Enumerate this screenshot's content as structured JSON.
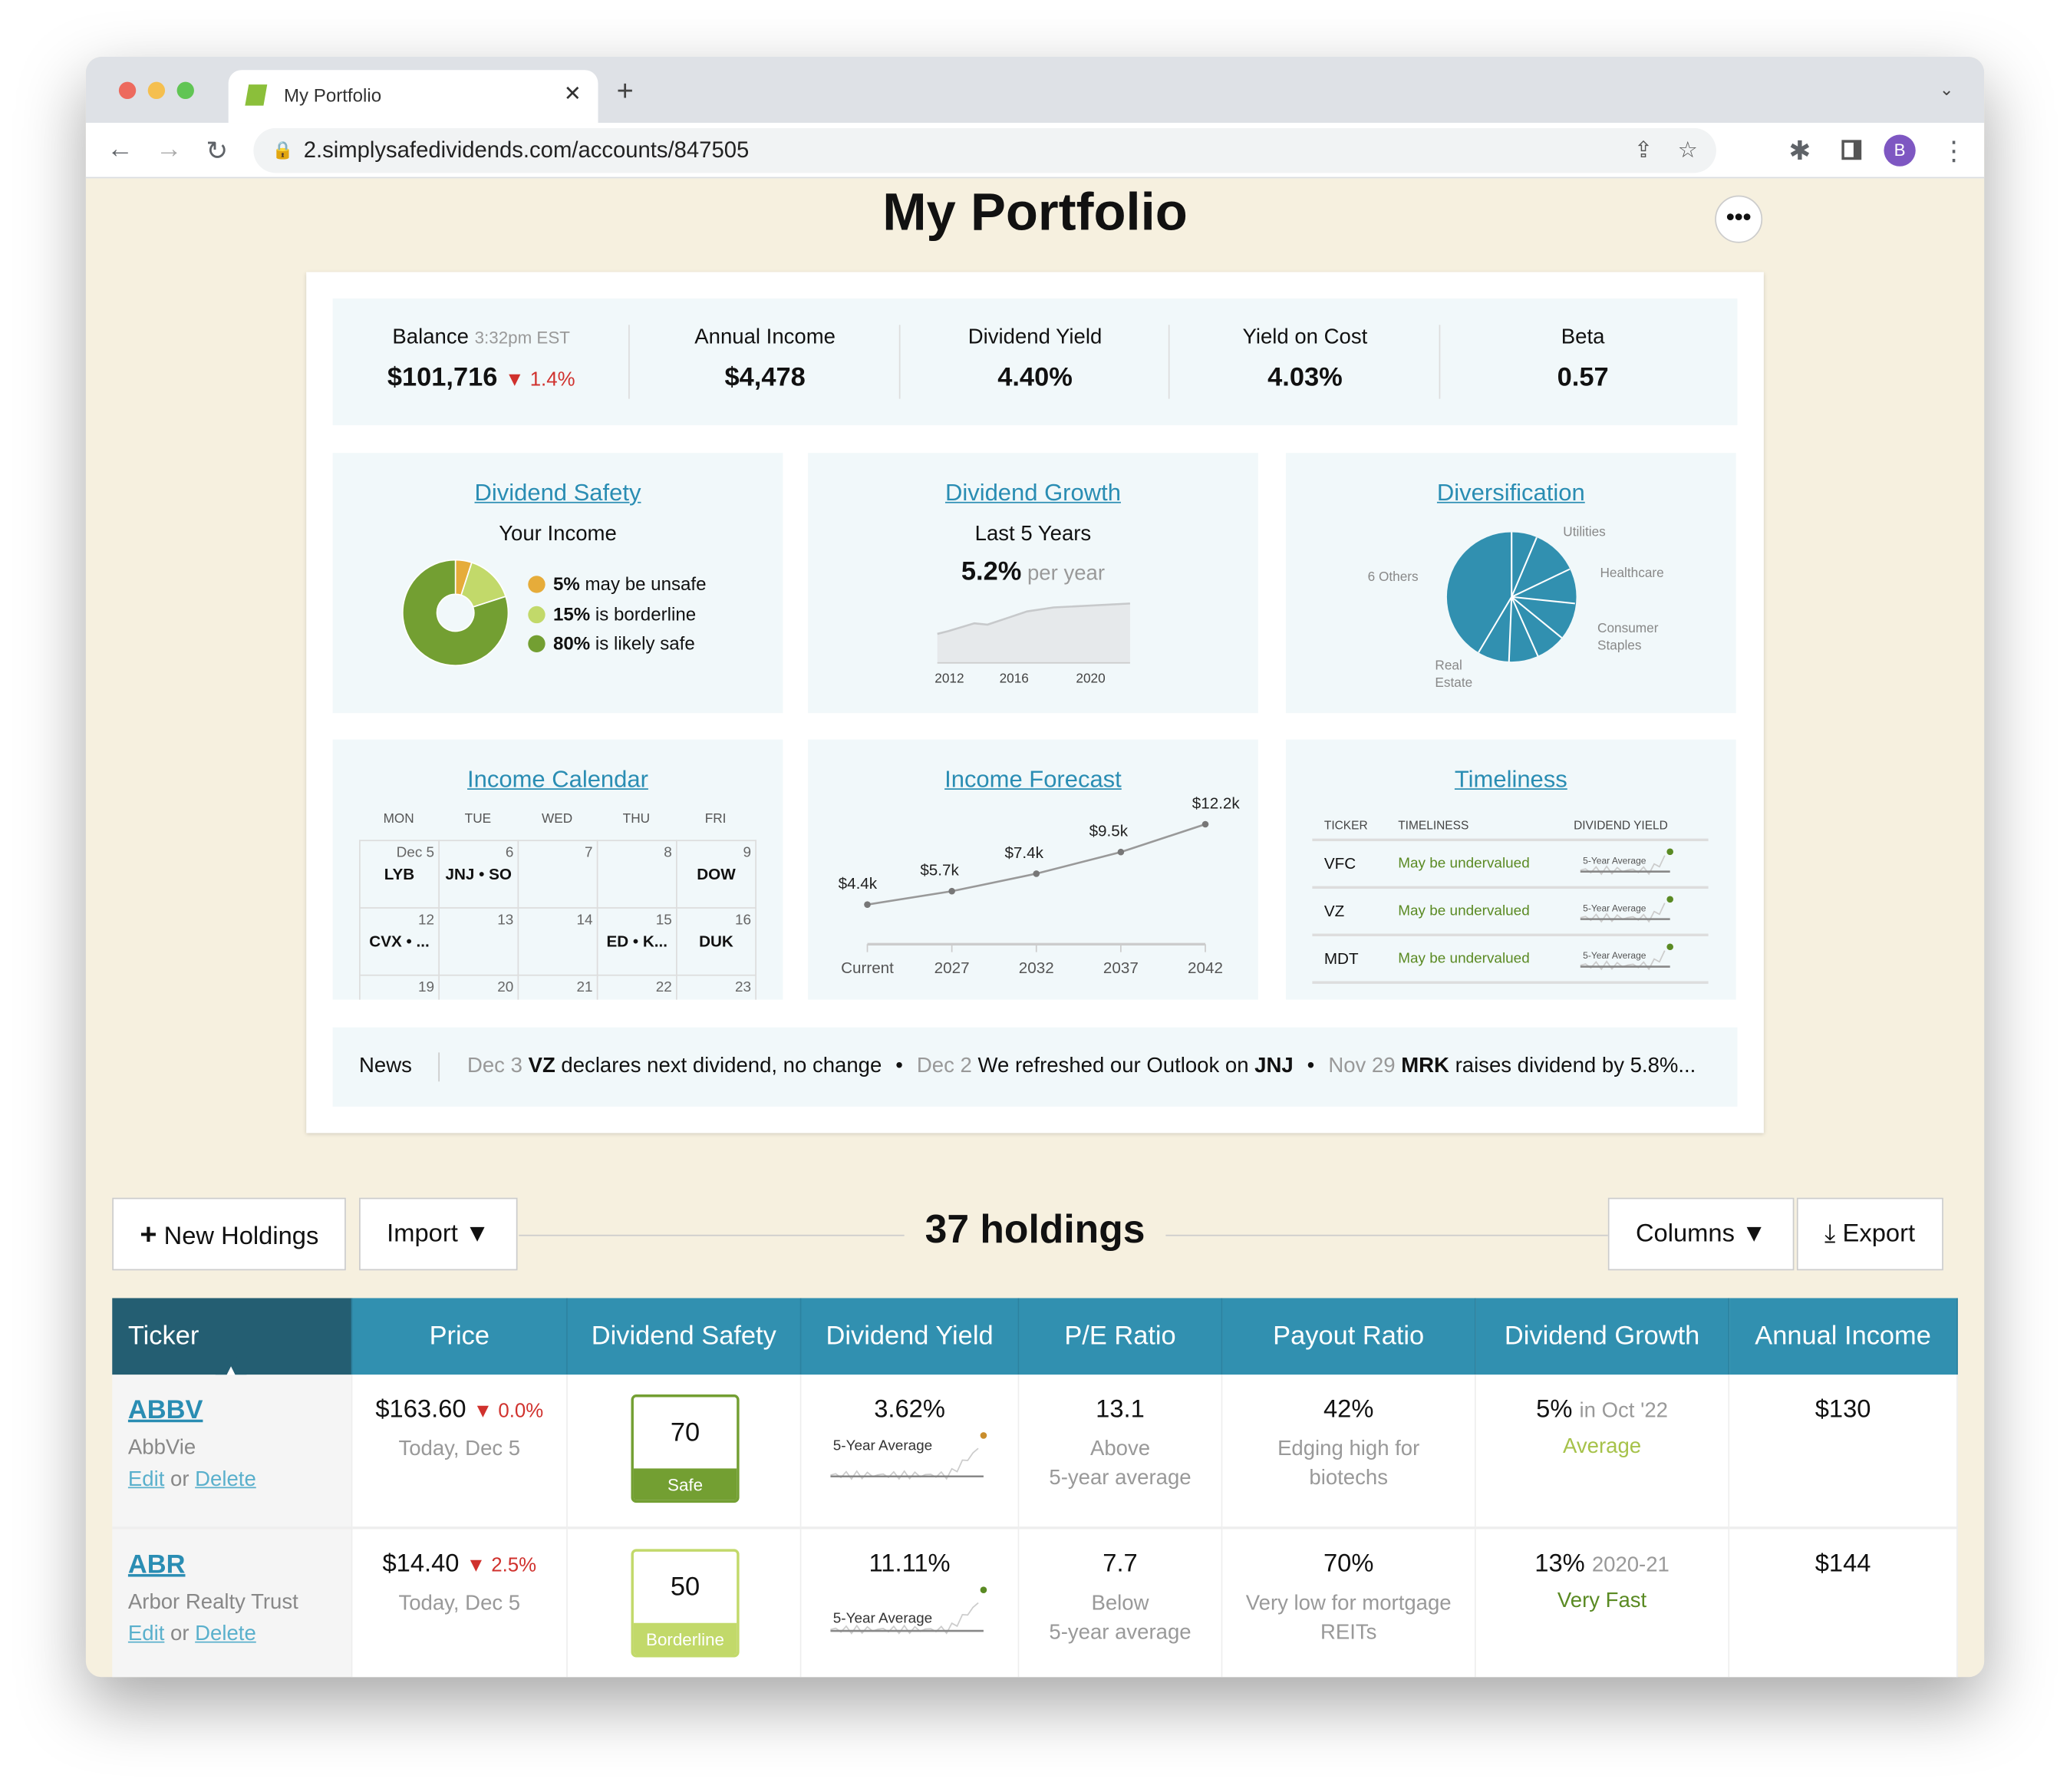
{
  "browser": {
    "tab_title": "My Portfolio",
    "url": "2.simplysafedividends.com/accounts/847505",
    "profile_initial": "B"
  },
  "page": {
    "title": "My Portfolio",
    "more_label": "•••"
  },
  "summary": [
    {
      "label": "Balance",
      "time": "3:32pm EST",
      "value": "$101,716",
      "change": "▼ 1.4%"
    },
    {
      "label": "Annual Income",
      "value": "$4,478"
    },
    {
      "label": "Dividend Yield",
      "value": "4.40%"
    },
    {
      "label": "Yield on Cost",
      "value": "4.03%"
    },
    {
      "label": "Beta",
      "value": "0.57"
    }
  ],
  "safety": {
    "title": "Dividend Safety",
    "subtitle": "Your Income",
    "legend": [
      {
        "pct": "5%",
        "text": "may be unsafe",
        "color": "#e6ac3a",
        "value": 5
      },
      {
        "pct": "15%",
        "text": "is borderline",
        "color": "#c2d96a",
        "value": 15
      },
      {
        "pct": "80%",
        "text": "is likely safe",
        "color": "#739f32",
        "value": 80
      }
    ]
  },
  "growth": {
    "title": "Dividend Growth",
    "subtitle": "Last 5 Years",
    "rate": "5.2%",
    "rate_suffix": "per year",
    "ticks": [
      "2012",
      "2016",
      "2020"
    ]
  },
  "diversification": {
    "title": "Diversification",
    "labels": [
      "Utilities",
      "Healthcare",
      "Consumer Staples",
      "Real Estate",
      "6 Others"
    ]
  },
  "calendar": {
    "title": "Income Calendar",
    "days": [
      "MON",
      "TUE",
      "WED",
      "THU",
      "FRI"
    ],
    "weeks": [
      [
        [
          "Dec 5",
          "LYB"
        ],
        [
          "6",
          "JNJ • SO"
        ],
        [
          "7",
          ""
        ],
        [
          "8",
          ""
        ],
        [
          "9",
          "DOW"
        ]
      ],
      [
        [
          "12",
          "CVX • ..."
        ],
        [
          "13",
          ""
        ],
        [
          "14",
          ""
        ],
        [
          "15",
          "ED • K..."
        ],
        [
          "16",
          "DUK"
        ]
      ],
      [
        [
          "19",
          ""
        ],
        [
          "20",
          ""
        ],
        [
          "21",
          ""
        ],
        [
          "22",
          ""
        ],
        [
          "23",
          ""
        ]
      ]
    ]
  },
  "forecast": {
    "title": "Income Forecast",
    "x": [
      "Current",
      "2027",
      "2032",
      "2037",
      "2042"
    ],
    "values": [
      4.4,
      5.7,
      7.4,
      9.5,
      12.2
    ],
    "labels": [
      "$4.4k",
      "$5.7k",
      "$7.4k",
      "$9.5k",
      "$12.2k"
    ]
  },
  "timeliness": {
    "title": "Timeliness",
    "headers": [
      "TICKER",
      "TIMELINESS",
      "DIVIDEND YIELD"
    ],
    "avg_label": "5-Year Average",
    "rows": [
      {
        "ticker": "VFC",
        "status": "May be undervalued"
      },
      {
        "ticker": "VZ",
        "status": "May be undervalued"
      },
      {
        "ticker": "MDT",
        "status": "May be undervalued"
      }
    ]
  },
  "news": {
    "label": "News",
    "items": [
      {
        "date": "Dec 3",
        "ticker": "VZ",
        "text": "declares next dividend, no change"
      },
      {
        "date": "Dec 2",
        "pre": "We refreshed our Outlook on",
        "ticker": "JNJ"
      },
      {
        "date": "Nov 29",
        "ticker": "MRK",
        "text": "raises dividend by 5.8%..."
      }
    ]
  },
  "holdings": {
    "new_label": "New Holdings",
    "import_label": "Import ▼",
    "count_label": "37 holdings",
    "columns_label": "Columns ▼",
    "export_label": "Export"
  },
  "table": {
    "headers": [
      "Ticker",
      "Price",
      "Dividend Safety",
      "Dividend Yield",
      "P/E Ratio",
      "Payout Ratio",
      "Dividend Growth",
      "Annual Income"
    ],
    "edit": "Edit",
    "or": "or",
    "delete": "Delete",
    "rows": [
      {
        "ticker": "ABBV",
        "name": "AbbVie",
        "price": "$163.60",
        "change": "▼ 0.0%",
        "date": "Today, Dec 5",
        "score": "70",
        "safety": "Safe",
        "safety_color": "#739f32",
        "yield": "3.62%",
        "avg": "5-Year Average",
        "pe": "13.1",
        "pe_note1": "Above",
        "pe_note2": "5-year average",
        "payout": "42%",
        "payout_note": "Edging high for biotechs",
        "growth": "5%",
        "growth_when": "in Oct '22",
        "growth_note": "Average",
        "growth_color": "#a6c24a",
        "income": "$130"
      },
      {
        "ticker": "ABR",
        "name": "Arbor Realty Trust",
        "price": "$14.40",
        "change": "▼ 2.5%",
        "date": "Today, Dec 5",
        "score": "50",
        "safety": "Borderline",
        "safety_color": "#c2d96a",
        "yield": "11.11%",
        "avg": "5-Year Average",
        "pe": "7.7",
        "pe_note1": "Below",
        "pe_note2": "5-year average",
        "payout": "70%",
        "payout_note": "Very low for mortgage REITs",
        "growth": "13%",
        "growth_when": "2020-21",
        "growth_note": "Very Fast",
        "growth_color": "#5a8a23",
        "income": "$144"
      }
    ]
  }
}
